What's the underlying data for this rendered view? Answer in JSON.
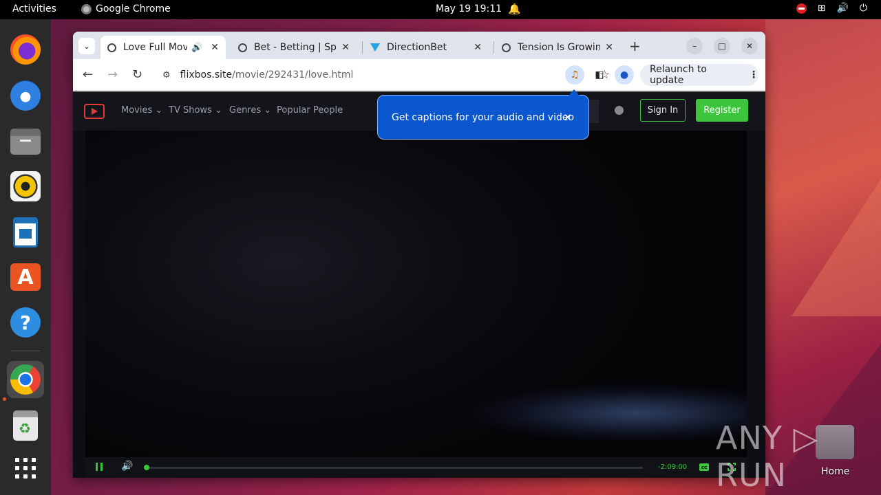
{
  "topbar": {
    "activities": "Activities",
    "app_name": "Google Chrome",
    "clock": "May 19  19:11"
  },
  "dock": {
    "items": [
      "firefox",
      "thunderbird",
      "files",
      "rhythmbox",
      "libreoffice-writer",
      "app-center",
      "help",
      "google-chrome",
      "trash",
      "show-apps"
    ]
  },
  "desktop": {
    "home_label": "Home"
  },
  "browser": {
    "tabs": [
      {
        "title": "Love Full Movi",
        "active": true,
        "playing_audio": true
      },
      {
        "title": "Bet - Betting | Spo",
        "active": false
      },
      {
        "title": "DirectionBet",
        "active": false
      },
      {
        "title": "Tension Is Growin",
        "active": false
      }
    ],
    "url_host": "flixbos.site",
    "url_path": "/movie/292431/love.html",
    "relaunch_label": "Relaunch to update",
    "captions_bubble": "Get captions for your audio and video"
  },
  "site": {
    "menu": [
      "Movies ⌄",
      "TV Shows ⌄",
      "Genres ⌄",
      "Popular People"
    ],
    "signin_label": "Sign In",
    "register_label": "Register"
  },
  "player": {
    "time_remaining": "-2:09:00",
    "progress": 0.005,
    "accent_color": "#3ec53e",
    "cc_label": "cc"
  },
  "watermark": "ANY ▷ RUN"
}
